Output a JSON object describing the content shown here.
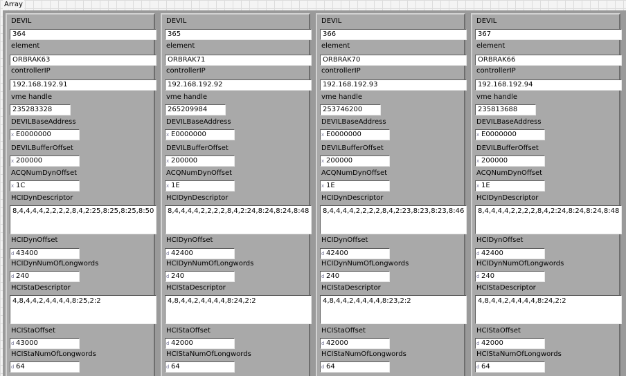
{
  "window": {
    "array_label": "Array"
  },
  "labels": {
    "devil": "DEVIL",
    "element": "element",
    "controller_ip": "controllerIP",
    "vme_handle": "vme handle",
    "devil_base_address": "DEVILBaseAddress",
    "devil_buffer_offset": "DEVILBufferOffset",
    "acq_num_dyn_offset": "ACQNumDynOffset",
    "hci_dyn_descriptor": "HCIDynDescriptor",
    "hci_dyn_offset": "HCIDynOffset",
    "hci_dyn_num_longwords": "HCIDynNumOfLongwords",
    "hci_sta_descriptor": "HCIStaDescriptor",
    "hci_sta_offset": "HCIStaOffset",
    "hci_sta_num_longwords": "HCIStaNumOfLongwords"
  },
  "radix": {
    "hex": "x",
    "dec": "d"
  },
  "clusters": [
    {
      "devil": "364",
      "element": "ORBRAK63",
      "controller_ip": "192.168.192.91",
      "vme_handle": "235283328",
      "devil_base_address": "E0000000",
      "devil_buffer_offset": "200000",
      "acq_num_dyn_offset": "1C",
      "hci_dyn_descriptor": "8,4,4,4,4,2,2,2,2,8,4,2:25,8:25,8:25,8:50",
      "hci_dyn_offset": "43400",
      "hci_dyn_num_longwords": "240",
      "hci_sta_descriptor": "4,8,4,4,2,4,4,4,4,8:25,2:2",
      "hci_sta_offset": "43000",
      "hci_sta_num_longwords": "64"
    },
    {
      "devil": "365",
      "element": "ORBRAK71",
      "controller_ip": "192.168.192.92",
      "vme_handle": "265209984",
      "devil_base_address": "E0000000",
      "devil_buffer_offset": "200000",
      "acq_num_dyn_offset": "1E",
      "hci_dyn_descriptor": "8,4,4,4,4,2,2,2,2,8,4,2:24,8:24,8:24,8:48",
      "hci_dyn_offset": "42400",
      "hci_dyn_num_longwords": "240",
      "hci_sta_descriptor": "4,8,4,4,2,4,4,4,4,8:24,2:2",
      "hci_sta_offset": "42000",
      "hci_sta_num_longwords": "64"
    },
    {
      "devil": "366",
      "element": "ORBRAK70",
      "controller_ip": "192.168.192.93",
      "vme_handle": "253746200",
      "devil_base_address": "E0000000",
      "devil_buffer_offset": "200000",
      "acq_num_dyn_offset": "1E",
      "hci_dyn_descriptor": "8,4,4,4,4,2,2,2,2,8,4,2:23,8:23,8:23,8:46",
      "hci_dyn_offset": "42400",
      "hci_dyn_num_longwords": "240",
      "hci_sta_descriptor": "4,8,4,4,2,4,4,4,4,8:23,2:2",
      "hci_sta_offset": "42000",
      "hci_sta_num_longwords": "64"
    },
    {
      "devil": "367",
      "element": "ORBRAK66",
      "controller_ip": "192.168.192.94",
      "vme_handle": "235813688",
      "devil_base_address": "E0000000",
      "devil_buffer_offset": "200000",
      "acq_num_dyn_offset": "1E",
      "hci_dyn_descriptor": "8,4,4,4,4,2,2,2,2,8,4,2:24,8:24,8:24,8:48",
      "hci_dyn_offset": "42400",
      "hci_dyn_num_longwords": "240",
      "hci_sta_descriptor": "4,8,4,4,2,4,4,4,4,8:24,2:2",
      "hci_sta_offset": "42000",
      "hci_sta_num_longwords": "64"
    }
  ]
}
